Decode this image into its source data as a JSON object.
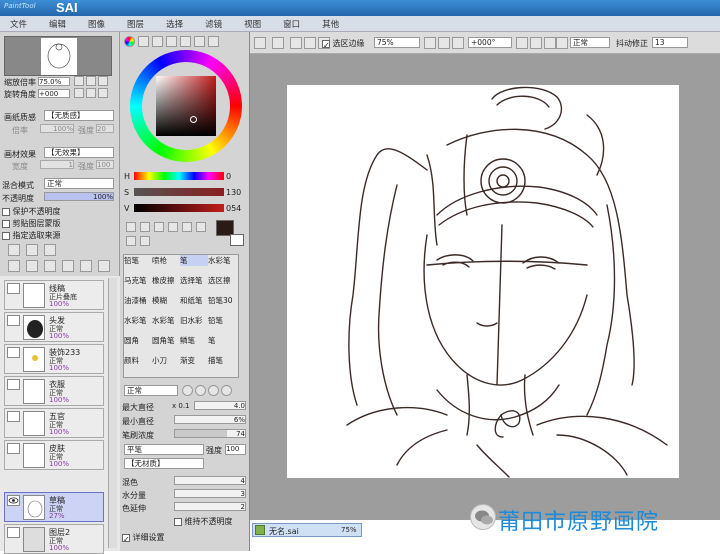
{
  "app": {
    "title_small": "PaintTool",
    "title_big": "SAI"
  },
  "menu": [
    "文件",
    "编辑",
    "图像",
    "图层",
    "选择",
    "滤镜",
    "视图",
    "窗口",
    "其他"
  ],
  "navigator": {
    "zoom_label": "缩放倍率",
    "zoom_value": "75.0%",
    "rotate_label": "旋转角度",
    "rotate_value": "+000"
  },
  "paper_texture": {
    "label": "画纸质感",
    "value": "【无质感】",
    "scale_label": "倍率",
    "scale_value": "100%",
    "strength_label": "强度",
    "strength_value": "20"
  },
  "paper_effect": {
    "label": "画材效果",
    "value": "【无效果】",
    "width_label": "宽度",
    "width_value": "1",
    "strength_label": "强度",
    "strength_value": "100"
  },
  "layer_props": {
    "blend_label": "混合模式",
    "blend_value": "正常",
    "opacity_label": "不透明度",
    "opacity_value": "100%",
    "protect_label": "保护不透明度",
    "clip_label": "剪贴图层蒙版",
    "source_label": "指定选取来源"
  },
  "layers": [
    {
      "name": "线稿",
      "mode": "正片叠底",
      "opacity": "100%"
    },
    {
      "name": "头发",
      "mode": "正常",
      "opacity": "100%"
    },
    {
      "name": "装饰233",
      "mode": "正常",
      "opacity": "100%"
    },
    {
      "name": "衣服",
      "mode": "正常",
      "opacity": "100%"
    },
    {
      "name": "五官",
      "mode": "正常",
      "opacity": "100%"
    },
    {
      "name": "皮肤",
      "mode": "正常",
      "opacity": "100%"
    },
    {
      "name": "草稿",
      "mode": "正常",
      "opacity": "27%"
    },
    {
      "name": "图层2",
      "mode": "正常",
      "opacity": "100%"
    }
  ],
  "color": {
    "h_label": "H",
    "h_value": "0",
    "s_label": "S",
    "s_value": "130",
    "v_label": "V",
    "v_value": "054",
    "current_color": "#2b1a17",
    "hue_color": "#c21d1d"
  },
  "tools": [
    [
      "铅笔",
      "喷枪",
      "笔",
      "水彩笔"
    ],
    [
      "马克笔",
      "橡皮擦",
      "选择笔",
      "选区擦"
    ],
    [
      "油漆桶",
      "模糊",
      "和纸笔",
      "铅笔30"
    ],
    [
      "水彩笔",
      "水彩笔",
      "旧水彩",
      "铅笔"
    ],
    [
      "圆角",
      "圆角笔",
      "鳞笔",
      "笔"
    ],
    [
      "颜料",
      "小刀",
      "渐变",
      "描笔"
    ]
  ],
  "brush": {
    "mode": "正常",
    "max_size_label": "最大直径",
    "max_size_mult": "x 0.1",
    "max_size_value": "4.0",
    "min_size_label": "最小直径",
    "min_size_value": "6%",
    "density_label": "笔刷浓度",
    "density_value": "74",
    "shape_value": "平笔",
    "shape_strength_label": "强度",
    "shape_strength_value": "100",
    "texture_value": "【无材质】",
    "blend_label": "混色",
    "blend_value": "4",
    "dilution_label": "水分量",
    "dilution_value": "3",
    "persistence_label": "色延伸",
    "persistence_value": "2",
    "keep_opacity_label": "维持不透明度",
    "detail_label": "详细设置"
  },
  "toolbar": {
    "selection_edge_label": "选区边缘",
    "zoom_value": "75%",
    "rotate_value": "+000°",
    "mode_value": "正常",
    "stabilizer_label": "抖动修正",
    "stabilizer_value": "13"
  },
  "document": {
    "name": "无名.sai",
    "zoom": "75%"
  },
  "watermark": "莆田市原野画院"
}
